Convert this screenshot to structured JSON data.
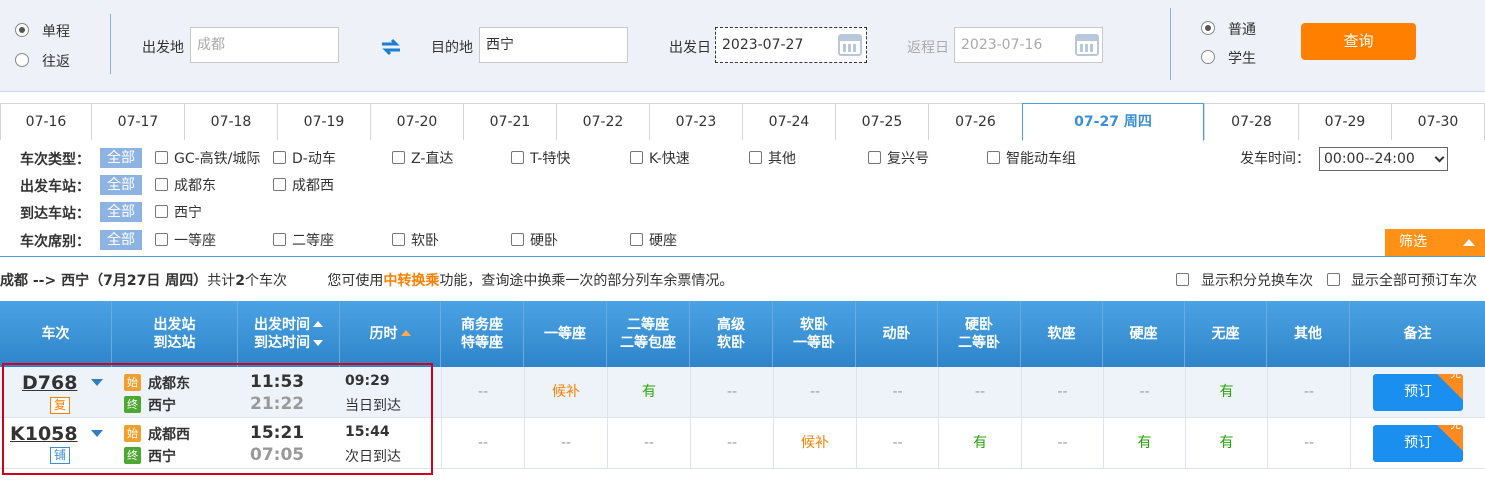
{
  "search": {
    "trip_types": [
      {
        "label": "单程",
        "checked": true
      },
      {
        "label": "往返",
        "checked": false
      }
    ],
    "from_label": "出发地",
    "from_placeholder": "成都",
    "to_label": "目的地",
    "to_value": "西宁",
    "depart_label": "出发日",
    "depart_value": "2023-07-27",
    "return_label": "返程日",
    "return_value": "2023-07-16",
    "passenger_types": [
      {
        "label": "普通",
        "checked": true
      },
      {
        "label": "学生",
        "checked": false
      }
    ],
    "query_button": "查询"
  },
  "date_tabs": [
    "07-16",
    "07-17",
    "07-18",
    "07-19",
    "07-20",
    "07-21",
    "07-22",
    "07-23",
    "07-24",
    "07-25",
    "07-26",
    "07-27 周四",
    "07-28",
    "07-29",
    "07-30"
  ],
  "active_date": "07-27 周四",
  "filters": {
    "train_type_label": "车次类型：",
    "all_label": "全部",
    "train_types": [
      "GC-高铁/城际",
      "D-动车",
      "Z-直达",
      "T-特快",
      "K-快速",
      "其他",
      "复兴号",
      "智能动车组"
    ],
    "depart_station_label": "出发车站：",
    "depart_stations": [
      "成都东",
      "成都西"
    ],
    "arrive_station_label": "到达车站：",
    "arrive_stations": [
      "西宁"
    ],
    "seat_label": "车次席别：",
    "seats": [
      "一等座",
      "二等座",
      "软卧",
      "硬卧",
      "硬座"
    ],
    "depart_time_label": "发车时间：",
    "depart_time_value": "00:00--24:00",
    "filter_button": "筛选"
  },
  "summary": {
    "route": "成都 --> 西宁（7月27日  周四）",
    "count_prefix": "共计",
    "count": "2",
    "count_suffix": "个车次",
    "tip_prefix": "您可使用",
    "tip_highlight": "中转换乘",
    "tip_suffix": "功能，查询途中换乘一次的部分列车余票情况。",
    "opt_points": "显示积分兑换车次",
    "opt_all": "显示全部可预订车次"
  },
  "table": {
    "headers": {
      "train": "车次",
      "station_1": "出发站",
      "station_2": "到达站",
      "time_1": "出发时间",
      "time_2": "到达时间",
      "duration": "历时",
      "c_business_1": "商务座",
      "c_business_2": "特等座",
      "c_first": "一等座",
      "c_second_1": "二等座",
      "c_second_2": "二等包座",
      "c_hsoft_1": "高级",
      "c_hsoft_2": "软卧",
      "c_soft_1": "软卧",
      "c_soft_2": "一等卧",
      "c_dong": "动卧",
      "c_hard_1": "硬卧",
      "c_hard_2": "二等卧",
      "c_softseat": "软座",
      "c_hardseat": "硬座",
      "c_noseat": "无座",
      "c_other": "其他",
      "remark": "备注"
    },
    "rows": [
      {
        "train_no": "D768",
        "tag": "复",
        "from_icon": "始",
        "from_station": "成都东",
        "to_icon": "终",
        "to_station": "西宁",
        "depart_time": "11:53",
        "arrive_time": "21:22",
        "duration": "09:29",
        "arrive_day": "当日到达",
        "seats": [
          "--",
          "候补",
          "有",
          "--",
          "--",
          "--",
          "--",
          "--",
          "--",
          "有",
          "--"
        ],
        "book": "预订",
        "corner": "兑"
      },
      {
        "train_no": "K1058",
        "tag": "铺",
        "from_icon": "始",
        "from_station": "成都西",
        "to_icon": "终",
        "to_station": "西宁",
        "depart_time": "15:21",
        "arrive_time": "07:05",
        "duration": "15:44",
        "arrive_day": "次日到达",
        "seats": [
          "--",
          "--",
          "--",
          "--",
          "候补",
          "--",
          "有",
          "--",
          "有",
          "有",
          "--"
        ],
        "book": "预订",
        "corner": "兑"
      }
    ]
  },
  "colors": {
    "accent_orange": "#ff8000",
    "header_blue": "#3d91d4",
    "available_green": "#26a306",
    "book_blue": "#1a8ff0",
    "highlight_red": "#d0021b"
  }
}
